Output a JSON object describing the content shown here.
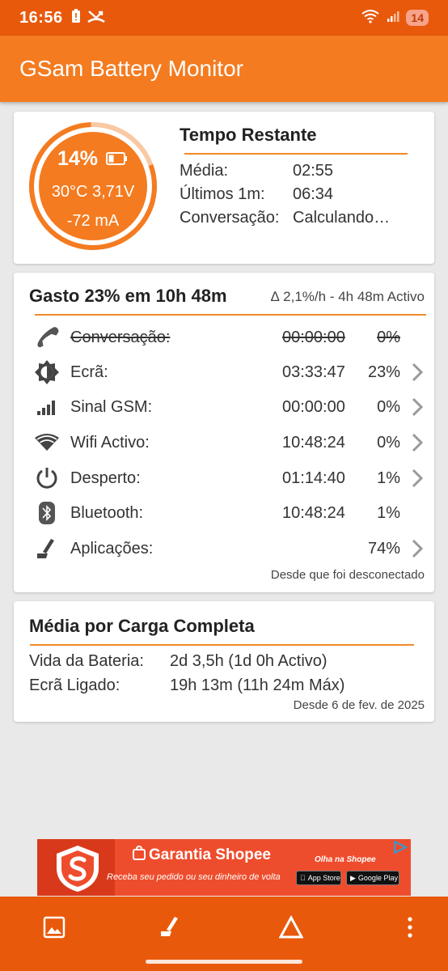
{
  "status_bar": {
    "time": "16:56",
    "battery_badge": "14"
  },
  "app": {
    "title": "GSam Battery Monitor"
  },
  "gauge": {
    "percent_text": "14%",
    "level_fraction": 0.14,
    "temp_voltage": "30°C  3,71V",
    "current": "-72 mA"
  },
  "time_remaining": {
    "title": "Tempo Restante",
    "rows": [
      {
        "label": "Média:",
        "value": "02:55"
      },
      {
        "label": "Últimos 1m:",
        "value": "06:34"
      },
      {
        "label": "Conversação:",
        "value": "Calculando…"
      }
    ]
  },
  "usage": {
    "title": "Gasto 23% em 10h 48m",
    "delta": "∆ 2,1%/h - 4h 48m Activo",
    "rows": [
      {
        "icon": "phone-icon",
        "label": "Conversação:",
        "time": "00:00:00",
        "percent": "0%",
        "struck": true,
        "has_chevron": false
      },
      {
        "icon": "brightness-icon",
        "label": "Ecrã:",
        "time": "03:33:47",
        "percent": "23%",
        "struck": false,
        "has_chevron": true
      },
      {
        "icon": "signal-icon",
        "label": "Sinal GSM:",
        "time": "00:00:00",
        "percent": "0%",
        "struck": false,
        "has_chevron": true
      },
      {
        "icon": "wifi-icon",
        "label": "Wifi Activo:",
        "time": "10:48:24",
        "percent": "0%",
        "struck": false,
        "has_chevron": true
      },
      {
        "icon": "power-icon",
        "label": "Desperto:",
        "time": "01:14:40",
        "percent": "1%",
        "struck": false,
        "has_chevron": true
      },
      {
        "icon": "bluetooth-icon",
        "label": "Bluetooth:",
        "time": "10:48:24",
        "percent": "1%",
        "struck": false,
        "has_chevron": false
      },
      {
        "icon": "apps-icon",
        "label": "Aplicações:",
        "time": "",
        "percent": "74%",
        "struck": false,
        "has_chevron": true
      }
    ],
    "footer": "Desde que foi desconectado"
  },
  "full_charge": {
    "title": "Média por Carga Completa",
    "rows": [
      {
        "label": "Vida da Bateria:",
        "value": "2d 3,5h (1d 0h Activo)"
      },
      {
        "label": "Ecrã Ligado:",
        "value": "19h 13m (11h 24m Máx)"
      }
    ],
    "footer": "Desde 6 de fev. de 2025"
  },
  "ad": {
    "brand": "Garantia Shopee",
    "tagline": "Receba seu pedido ou seu dinheiro de volta",
    "cta": "Olha na Shopee",
    "store1": "App Store",
    "store2": "Google Play"
  },
  "colors": {
    "status_bar": "#e8590c",
    "app_bar": "#f47b20",
    "accent_line": "#f08a2a",
    "gauge_fill": "#f47b20"
  }
}
